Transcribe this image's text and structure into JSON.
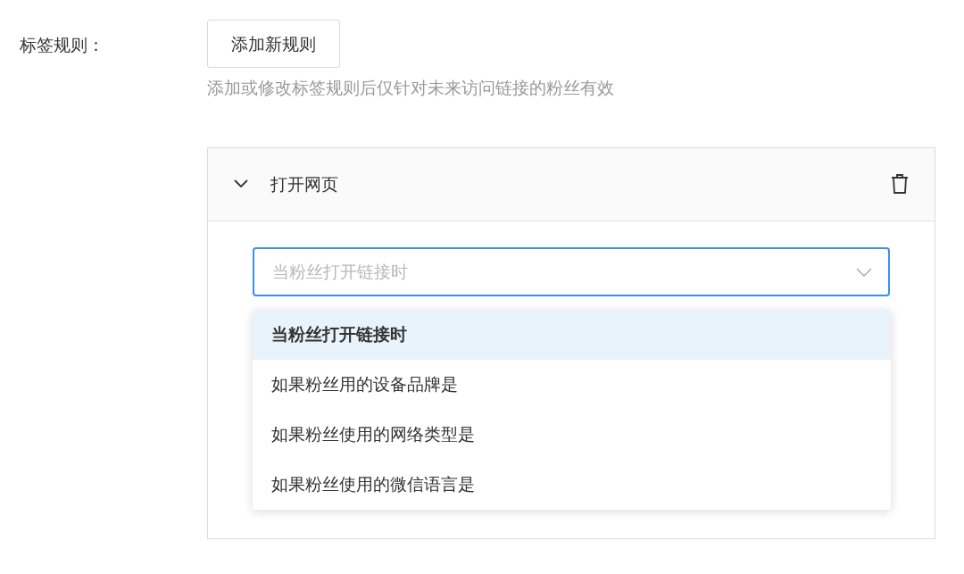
{
  "field_label": "标签规则：",
  "add_button": "添加新规则",
  "hint": "添加或修改标签规则后仅针对未来访问链接的粉丝有效",
  "rule": {
    "title": "打开网页",
    "expanded": true
  },
  "select": {
    "placeholder": "当粉丝打开链接时",
    "open": true
  },
  "options": [
    {
      "label": "当粉丝打开链接时",
      "selected": true
    },
    {
      "label": "如果粉丝用的设备品牌是",
      "selected": false
    },
    {
      "label": "如果粉丝使用的网络类型是",
      "selected": false
    },
    {
      "label": "如果粉丝使用的微信语言是",
      "selected": false
    }
  ]
}
